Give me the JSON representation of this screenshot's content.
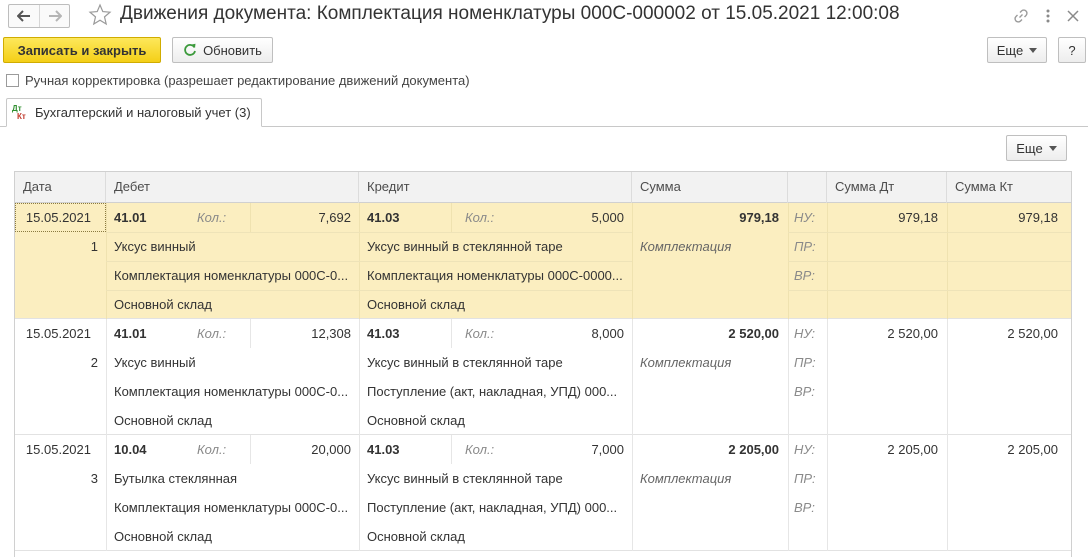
{
  "window": {
    "title": "Движения документа: Комплектация номенклатуры 000С-000002 от 15.05.2021 12:00:08"
  },
  "toolbar": {
    "save_close_label": "Записать и закрыть",
    "refresh_label": "Обновить",
    "more_label": "Еще",
    "help_label": "?"
  },
  "manual_adjust": {
    "label": "Ручная корректировка (разрешает редактирование движений документа)",
    "checked": false
  },
  "tab": {
    "label": "Бухгалтерский и налоговый учет (3)",
    "icon_top": "Дт",
    "icon_bottom": "Кт"
  },
  "table": {
    "more_label": "Еще",
    "headers": {
      "date": "Дата",
      "debit": "Дебет",
      "credit": "Кредит",
      "sum": "Сумма",
      "sum_dt": "Сумма Дт",
      "sum_kt": "Сумма Кт"
    },
    "rows": [
      {
        "date": "15.05.2021",
        "num": "1",
        "dt_account": "41.01",
        "dt_qty_label": "Кол.:",
        "dt_qty": "7,692",
        "dt_sub1": "Уксус винный",
        "dt_sub2": "Комплектация номенклатуры 000С-0...",
        "dt_sub3": "Основной склад",
        "kt_account": "41.03",
        "kt_qty_label": "Кол.:",
        "kt_qty": "5,000",
        "kt_sub1": "Уксус винный в стеклянной таре",
        "kt_sub2": "Комплектация номенклатуры 000С-0000...",
        "kt_sub3": "Основной склад",
        "sum": "979,18",
        "content": "Комплектация",
        "nu_label": "НУ:",
        "pr_label": "ПР:",
        "vr_label": "ВР:",
        "sum_dt": "979,18",
        "sum_kt": "979,18"
      },
      {
        "date": "15.05.2021",
        "num": "2",
        "dt_account": "41.01",
        "dt_qty_label": "Кол.:",
        "dt_qty": "12,308",
        "dt_sub1": "Уксус винный",
        "dt_sub2": "Комплектация номенклатуры 000С-0...",
        "dt_sub3": "Основной склад",
        "kt_account": "41.03",
        "kt_qty_label": "Кол.:",
        "kt_qty": "8,000",
        "kt_sub1": "Уксус винный в стеклянной таре",
        "kt_sub2": "Поступление (акт, накладная, УПД) 000...",
        "kt_sub3": "Основной склад",
        "sum": "2 520,00",
        "content": "Комплектация",
        "nu_label": "НУ:",
        "pr_label": "ПР:",
        "vr_label": "ВР:",
        "sum_dt": "2 520,00",
        "sum_kt": "2 520,00"
      },
      {
        "date": "15.05.2021",
        "num": "3",
        "dt_account": "10.04",
        "dt_qty_label": "Кол.:",
        "dt_qty": "20,000",
        "dt_sub1": "Бутылка стеклянная",
        "dt_sub2": "Комплектация номенклатуры 000С-0...",
        "dt_sub3": "Основной склад",
        "kt_account": "41.03",
        "kt_qty_label": "Кол.:",
        "kt_qty": "7,000",
        "kt_sub1": "Уксус винный в стеклянной таре",
        "kt_sub2": "Поступление (акт, накладная, УПД) 000...",
        "kt_sub3": "Основной склад",
        "sum": "2 205,00",
        "content": "Комплектация",
        "nu_label": "НУ:",
        "pr_label": "ПР:",
        "vr_label": "ВР:",
        "sum_dt": "2 205,00",
        "sum_kt": "2 205,00"
      }
    ]
  },
  "colors": {
    "primary_button": "#f4cf17",
    "selected_row": "#fbeec0",
    "header_bg": "#f2f2f2"
  }
}
